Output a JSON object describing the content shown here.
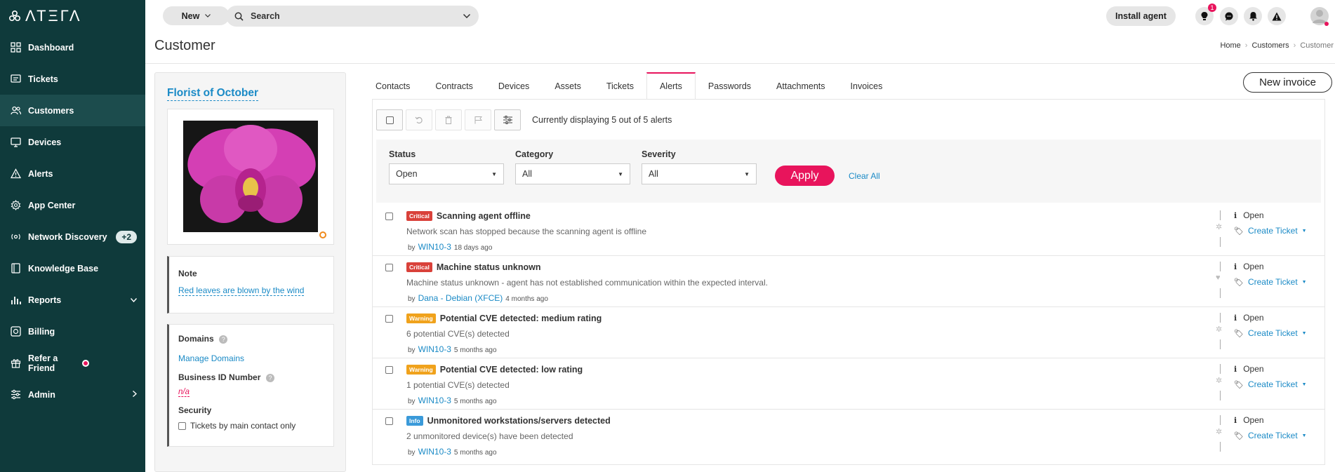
{
  "app": {
    "logo_text": "ΛΤΞΓΛ"
  },
  "sidebar": {
    "items": [
      {
        "label": "Dashboard",
        "icon": "dashboard-icon"
      },
      {
        "label": "Tickets",
        "icon": "tickets-icon"
      },
      {
        "label": "Customers",
        "icon": "customers-icon",
        "active": true
      },
      {
        "label": "Devices",
        "icon": "devices-icon"
      },
      {
        "label": "Alerts",
        "icon": "alerts-icon"
      },
      {
        "label": "App Center",
        "icon": "app-center-icon"
      },
      {
        "label": "Network Discovery",
        "icon": "network-icon",
        "badge": "+2"
      },
      {
        "label": "Knowledge Base",
        "icon": "book-icon"
      },
      {
        "label": "Reports",
        "icon": "reports-icon",
        "chevron": "down"
      },
      {
        "label": "Billing",
        "icon": "billing-icon"
      },
      {
        "label": "Refer a Friend",
        "icon": "gift-icon",
        "dot": true
      },
      {
        "label": "Admin",
        "icon": "admin-icon",
        "chevron": "right"
      }
    ]
  },
  "topbar": {
    "new_label": "New",
    "search_placeholder": "Search",
    "install_label": "Install agent",
    "notification_count": "1"
  },
  "page": {
    "title": "Customer",
    "breadcrumb": [
      "Home",
      "Customers",
      "Customer"
    ]
  },
  "customer": {
    "name": "Florist of October",
    "note_label": "Note",
    "note_text": "Red leaves are blown by the wind",
    "domains_label": "Domains",
    "manage_domains": "Manage Domains",
    "business_id_label": "Business ID Number",
    "business_id_value": "n/a",
    "security_label": "Security",
    "security_option": "Tickets by main contact only"
  },
  "tabs": [
    "Contacts",
    "Contracts",
    "Devices",
    "Assets",
    "Tickets",
    "Alerts",
    "Passwords",
    "Attachments",
    "Invoices"
  ],
  "active_tab": "Alerts",
  "new_invoice_label": "New invoice",
  "toolbar": {
    "display_text": "Currently displaying 5 out of 5 alerts"
  },
  "filters": {
    "status_label": "Status",
    "status_value": "Open",
    "category_label": "Category",
    "category_value": "All",
    "severity_label": "Severity",
    "severity_value": "All",
    "apply_label": "Apply",
    "clear_label": "Clear All"
  },
  "alerts": [
    {
      "severity": "Critical",
      "sev_class": "critical",
      "title": "Scanning agent offline",
      "desc": "Network scan has stopped because the scanning agent is offline",
      "by": "by",
      "device": "WIN10-3",
      "time": "18 days ago",
      "status": "Open",
      "action": "Create Ticket"
    },
    {
      "severity": "Critical",
      "sev_class": "critical",
      "title": "Machine status unknown",
      "desc": "Machine status unknown - agent has not established communication within the expected interval.",
      "by": "by",
      "device": "Dana - Debian (XFCE)",
      "time": "4 months ago",
      "status": "Open",
      "action": "Create Ticket"
    },
    {
      "severity": "Warning",
      "sev_class": "warning",
      "title": "Potential CVE detected: medium rating",
      "desc": "6 potential CVE(s) detected",
      "by": "by",
      "device": "WIN10-3",
      "time": "5 months ago",
      "status": "Open",
      "action": "Create Ticket"
    },
    {
      "severity": "Warning",
      "sev_class": "warning",
      "title": "Potential CVE detected: low rating",
      "desc": "1 potential CVE(s) detected",
      "by": "by",
      "device": "WIN10-3",
      "time": "5 months ago",
      "status": "Open",
      "action": "Create Ticket"
    },
    {
      "severity": "Info",
      "sev_class": "info",
      "title": "Unmonitored workstations/servers detected",
      "desc": "2 unmonitored device(s) have been detected",
      "by": "by",
      "device": "WIN10-3",
      "time": "5 months ago",
      "status": "Open",
      "action": "Create Ticket"
    }
  ],
  "colors": {
    "sidebar_bg": "#0f3a3b",
    "accent": "#e8145c",
    "link": "#1a8ac6"
  }
}
